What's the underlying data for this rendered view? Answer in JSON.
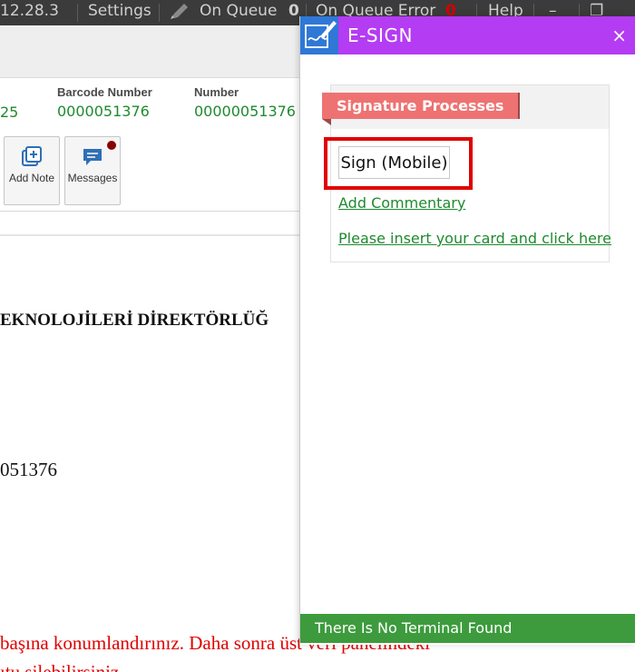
{
  "topbar": {
    "version": "12.28.3",
    "settings": "Settings",
    "on_queue": "On Queue",
    "on_queue_count": "0",
    "on_queue_error": "On Queue Error",
    "on_queue_error_count": "0",
    "help": "Help",
    "minimize_glyph": "–",
    "restore_glyph": "❐"
  },
  "document_info": {
    "prefix_value": "25",
    "barcode_label": "Barcode Number",
    "barcode_value": "0000051376",
    "number_label": "Number",
    "number_value": "00000051376"
  },
  "actions": {
    "add_note": "Add Note",
    "messages": "Messages"
  },
  "document_body": {
    "title_fragment": "EKNOLOJİLERİ DİREKTÖRLÜĞ",
    "number_fragment": "051376",
    "red_line_1": "başına konumlandırınız. Daha sonra üst veri panelindeki",
    "red_line_2": "ıtu silebilirsiniz."
  },
  "esign_panel": {
    "title": "E-SIGN",
    "close_glyph": "×",
    "section_title": "Signature Processes",
    "sign_mobile_button": "Sign (Mobile)",
    "add_commentary_link": "Add Commentary",
    "insert_card_link": "Please insert your card and click here",
    "status_text": "There Is No Terminal Found"
  },
  "colors": {
    "panel_header": "#b43cf2",
    "panel_logo_bg": "#2f78d6",
    "section_tab": "#ee7272",
    "highlight": "#e00000",
    "link_green": "#1e8a2e",
    "status_green": "#3d9b3d",
    "topbar_bg": "#3b3b3b"
  },
  "icons": {
    "on_queue_icon": "pen-icon",
    "add_note_icon": "add-note-icon",
    "messages_icon": "chat-icon",
    "esign_logo": "signature-pen-icon"
  }
}
